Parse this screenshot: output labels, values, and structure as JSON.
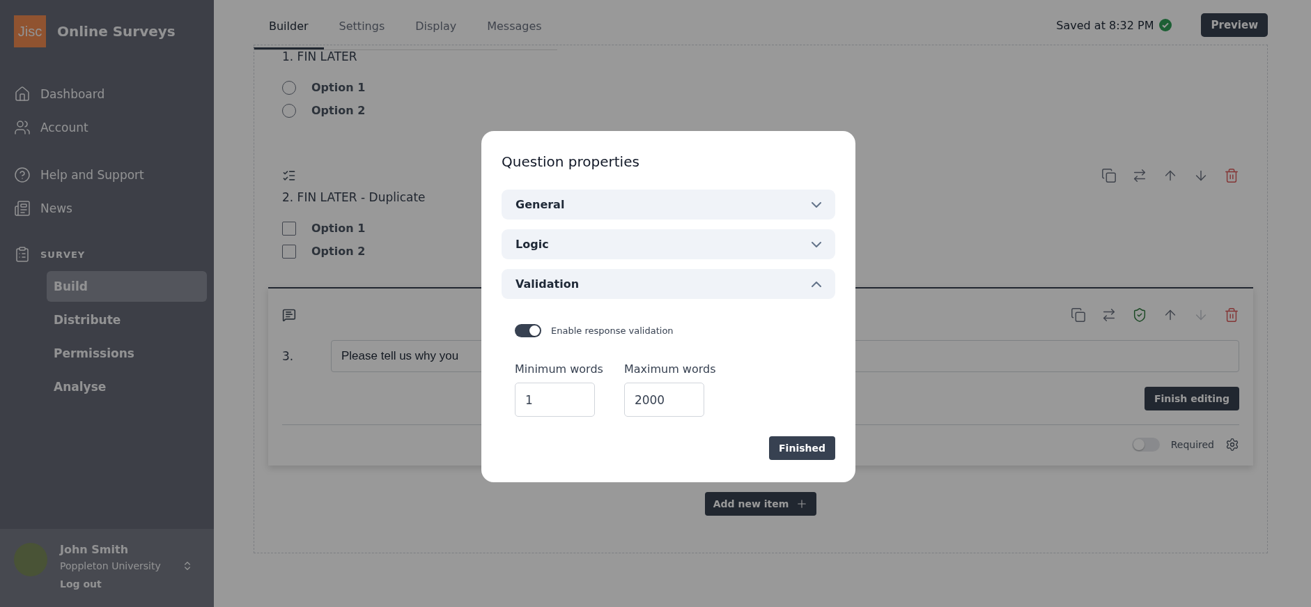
{
  "sidebar": {
    "logo": "Jisc",
    "title": "Online Surveys",
    "nav_groups": [
      [
        {
          "label": "Dashboard"
        },
        {
          "label": "Account"
        }
      ],
      [
        {
          "label": "Help and Support"
        },
        {
          "label": "News"
        }
      ]
    ],
    "section": {
      "heading": "SURVEY",
      "items": [
        {
          "label": "Build",
          "selected": true
        },
        {
          "label": "Distribute",
          "selected": false
        },
        {
          "label": "Permissions",
          "selected": false
        },
        {
          "label": "Analyse",
          "selected": false
        }
      ]
    },
    "user": {
      "name": "John Smith",
      "org": "Poppleton University",
      "logout": "Log out"
    }
  },
  "tabs": [
    {
      "label": "Builder",
      "selected": true
    },
    {
      "label": "Settings",
      "selected": false
    },
    {
      "label": "Display",
      "selected": false
    },
    {
      "label": "Messages",
      "selected": false
    }
  ],
  "save_status": "Saved at 8:32 PM",
  "preview_button": "Preview",
  "questions": [
    {
      "kind": "radio",
      "title": "1. FIN LATER",
      "options": [
        {
          "label": "Option 1",
          "checked": false
        },
        {
          "label": "Option 2",
          "checked": false
        }
      ]
    },
    {
      "kind": "checkbox",
      "title": "2. FIN LATER - Duplicate",
      "options": [
        {
          "label": "Option 1",
          "checked": false
        },
        {
          "label": "Option 2",
          "checked": false
        }
      ],
      "actions": [
        {
          "kind": "copy",
          "disabled": false
        },
        {
          "kind": "swap",
          "disabled": false
        },
        {
          "kind": "up",
          "disabled": false
        },
        {
          "kind": "down",
          "disabled": false
        },
        {
          "kind": "delete",
          "disabled": false
        }
      ]
    },
    {
      "kind": "text",
      "number": "3.",
      "value": "Please tell us why you",
      "actions": [
        {
          "kind": "copy",
          "disabled": false
        },
        {
          "kind": "swap",
          "disabled": false
        },
        {
          "kind": "validation",
          "disabled": false
        },
        {
          "kind": "up",
          "disabled": false
        },
        {
          "kind": "down",
          "disabled": true
        },
        {
          "kind": "delete",
          "disabled": false
        }
      ],
      "finish_button": "Finish editing",
      "required": {
        "label": "Required",
        "on": false
      }
    }
  ],
  "add_item_button": "Add new item",
  "modal": {
    "title": "Question properties",
    "sections": [
      {
        "label": "General",
        "expanded": false
      },
      {
        "label": "Logic",
        "expanded": false
      },
      {
        "label": "Validation",
        "expanded": true,
        "content": {
          "toggle": {
            "label": "Enable response validation",
            "on": true
          },
          "fields": [
            {
              "label": "Minimum words",
              "value": "1"
            },
            {
              "label": "Maximum words",
              "value": "2000"
            }
          ]
        }
      }
    ],
    "finish_button": "Finished"
  }
}
